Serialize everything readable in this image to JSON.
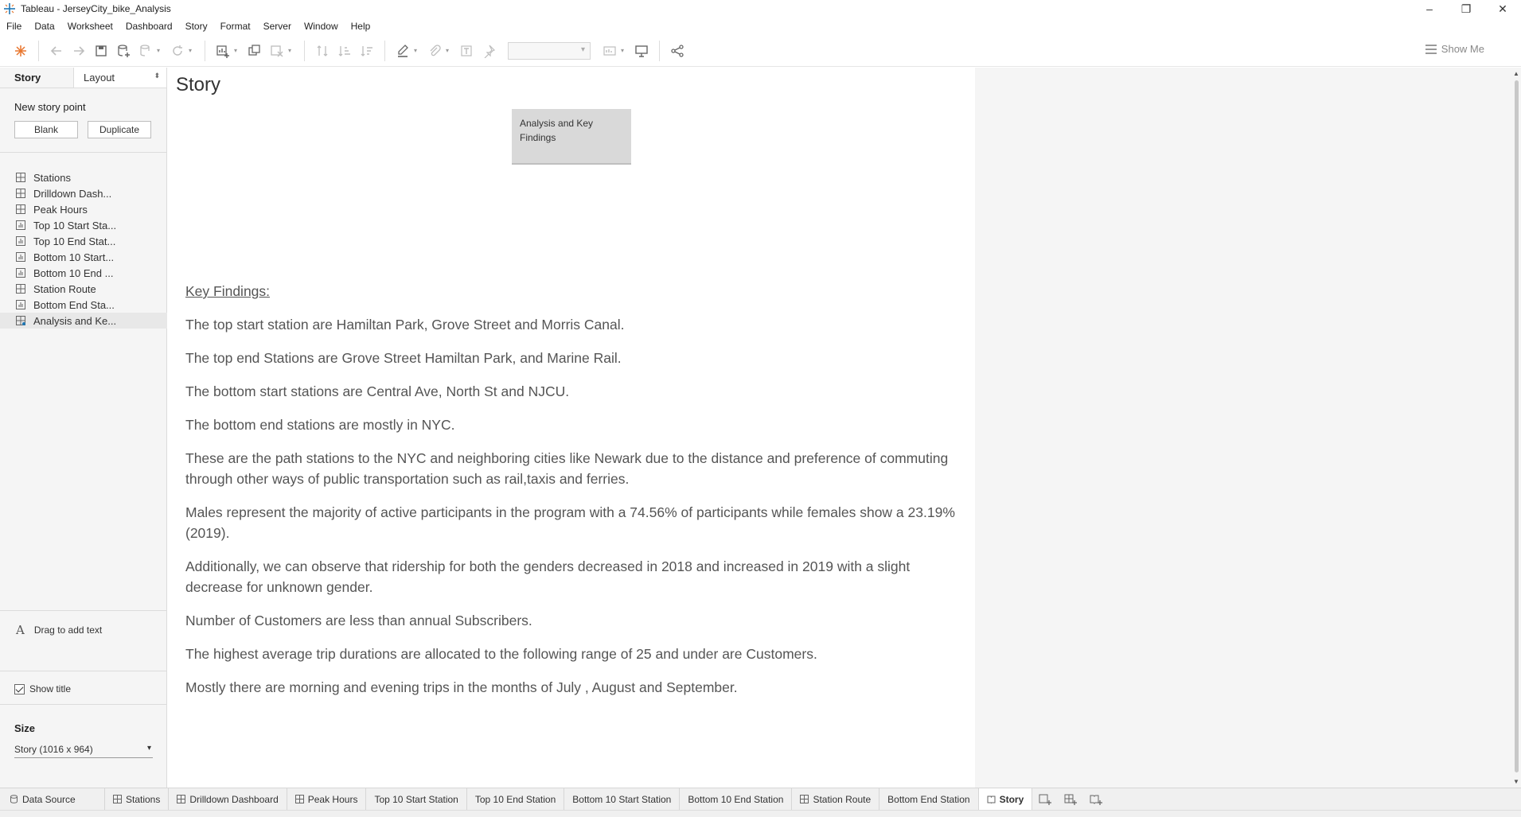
{
  "window": {
    "title": "Tableau - JerseyCity_bike_Analysis",
    "controls": [
      "–",
      "❐",
      "✕"
    ]
  },
  "menu": [
    "File",
    "Data",
    "Worksheet",
    "Dashboard",
    "Story",
    "Format",
    "Server",
    "Window",
    "Help"
  ],
  "toolbar": {
    "show_me": "Show Me"
  },
  "left_pane": {
    "tabs": {
      "story": "Story",
      "layout": "Layout"
    },
    "new_story_point": "New story point",
    "blank_button": "Blank",
    "duplicate_button": "Duplicate",
    "sheets": [
      {
        "label": "Stations",
        "icon": "dashboard-icon"
      },
      {
        "label": "Drilldown Dash...",
        "icon": "dashboard-icon"
      },
      {
        "label": "Peak Hours",
        "icon": "dashboard-icon"
      },
      {
        "label": "Top 10 Start Sta...",
        "icon": "worksheet-icon"
      },
      {
        "label": "Top 10 End Stat...",
        "icon": "worksheet-icon"
      },
      {
        "label": "Bottom 10 Start...",
        "icon": "worksheet-icon"
      },
      {
        "label": "Bottom 10 End ...",
        "icon": "worksheet-icon"
      },
      {
        "label": "Station Route",
        "icon": "dashboard-icon"
      },
      {
        "label": "Bottom End Sta...",
        "icon": "worksheet-icon"
      },
      {
        "label": "Analysis and Ke...",
        "icon": "dashboard-icon",
        "selected": true
      }
    ],
    "drag_to_add_text": "Drag to add text",
    "show_title": "Show title",
    "size_label": "Size",
    "size_value": "Story (1016 x 964)"
  },
  "story": {
    "title": "Story",
    "story_point_caption": "Analysis and Key Findings",
    "findings_heading": "Key Findings:",
    "findings": [
      "The top start station are Hamiltan Park, Grove Street and Morris Canal.",
      "The top end Stations are  Grove Street Hamiltan Park, and Marine Rail.",
      "The bottom start stations are Central Ave, North St and NJCU.",
      "The bottom end stations are mostly in NYC.",
      "These are the path stations to the NYC and neighboring cities like Newark due to the distance and preference of commuting through other ways of public transportation such as rail,taxis and ferries.",
      "Males represent the majority of active participants in the program with a 74.56% of participants while females show a 23.19% (2019).",
      "Additionally, we can observe that ridership for both the genders decreased in 2018  and increased in 2019 with a slight decrease for unknown gender.",
      "Number of Customers are less than annual Subscribers.",
      "The highest average trip durations are allocated to the following range of 25 and under are Customers.",
      "Mostly there are morning and evening trips in the months of July , August and September."
    ]
  },
  "bottom_tabs": [
    {
      "label": "Data Source",
      "icon": "database-icon"
    },
    {
      "label": "Stations",
      "icon": "dashboard-icon"
    },
    {
      "label": "Drilldown Dashboard",
      "icon": "dashboard-icon"
    },
    {
      "label": "Peak Hours",
      "icon": "dashboard-icon"
    },
    {
      "label": "Top 10 Start Station",
      "icon": ""
    },
    {
      "label": "Top 10 End Station",
      "icon": ""
    },
    {
      "label": "Bottom 10 Start Station",
      "icon": ""
    },
    {
      "label": "Bottom 10 End Station",
      "icon": ""
    },
    {
      "label": "Station Route",
      "icon": "dashboard-icon"
    },
    {
      "label": "Bottom End Station",
      "icon": ""
    },
    {
      "label": "Story",
      "icon": "story-icon",
      "active": true
    }
  ],
  "colors": {
    "tableau_accent": "#1f77b4",
    "story_point_bg": "#d9d9d9",
    "pane_bg": "#f5f5f5"
  }
}
